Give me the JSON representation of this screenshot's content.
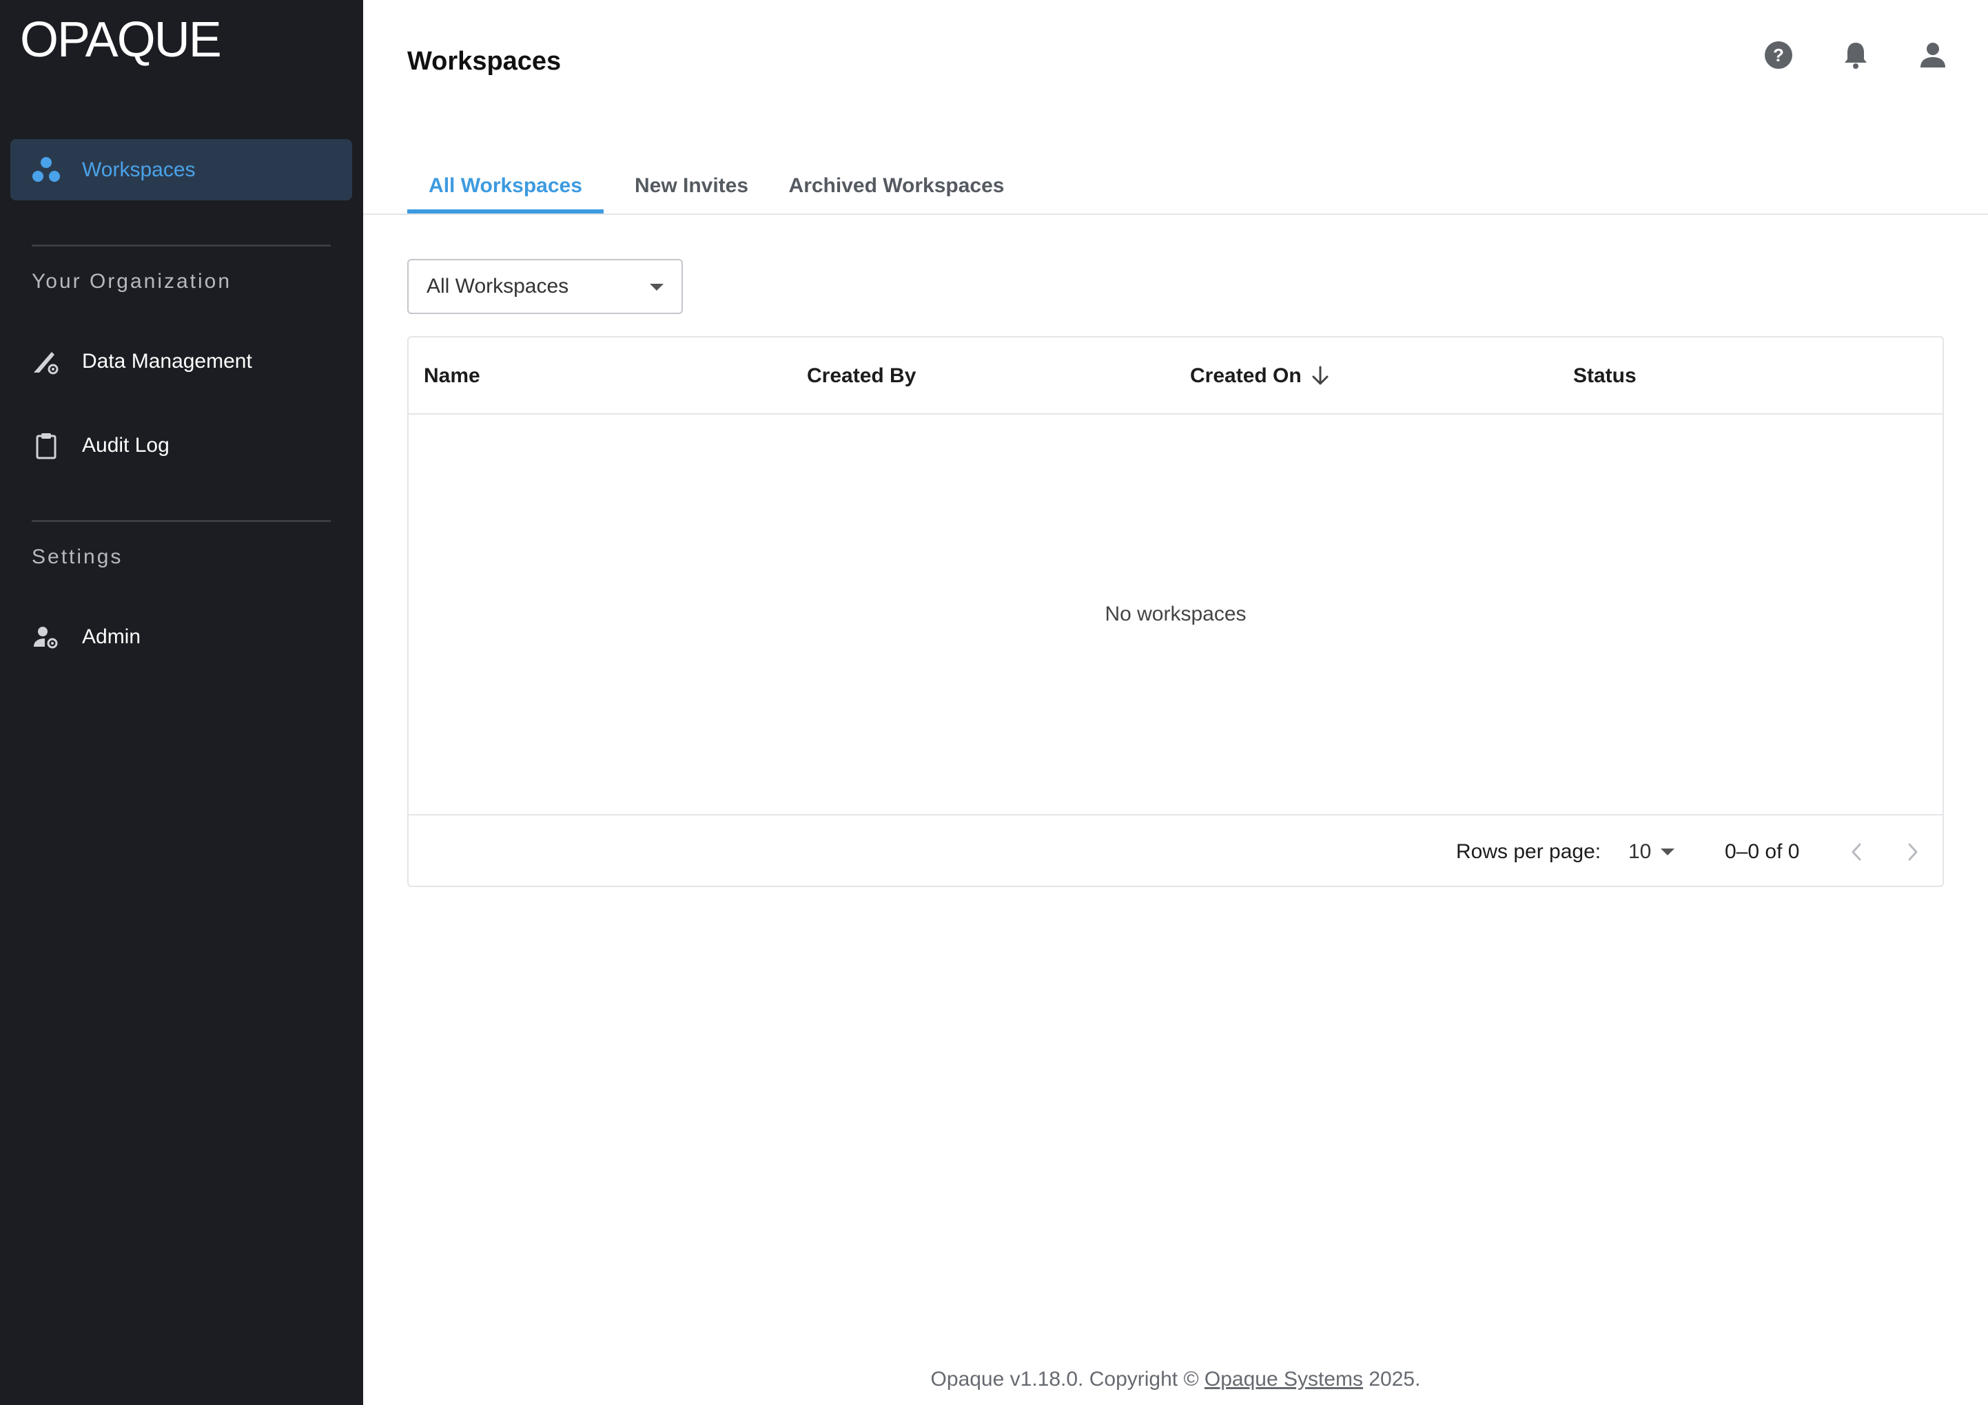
{
  "app": {
    "logo": "OPAQUE"
  },
  "sidebar": {
    "items": [
      {
        "label": "Workspaces",
        "icon": "workspaces-icon",
        "active": true
      },
      {
        "label": "Data Management",
        "icon": "data-management-icon"
      },
      {
        "label": "Audit Log",
        "icon": "clipboard-icon"
      },
      {
        "label": "Admin",
        "icon": "admin-settings-icon"
      }
    ],
    "sections": {
      "organization": "Your Organization",
      "settings": "Settings"
    }
  },
  "header": {
    "title": "Workspaces",
    "icons": [
      "help-icon",
      "notifications-icon",
      "account-icon"
    ]
  },
  "tabs": [
    {
      "label": "All Workspaces",
      "active": true
    },
    {
      "label": "New Invites"
    },
    {
      "label": "Archived Workspaces"
    }
  ],
  "filter": {
    "selected": "All Workspaces"
  },
  "table": {
    "columns": [
      "Name",
      "Created By",
      "Created On",
      "Status"
    ],
    "sorted_column": "Created On",
    "sort_direction": "desc",
    "empty_message": "No workspaces",
    "rows": []
  },
  "pagination": {
    "rows_per_page_label": "Rows per page:",
    "rows_per_page": "10",
    "range": "0–0 of 0"
  },
  "footer": {
    "prefix": "Opaque v1.18.0. Copyright ©",
    "link": "Opaque Systems",
    "suffix": "2025."
  },
  "colors": {
    "sidebar_bg": "#1b1d22",
    "active_item_bg": "#2a3a4e",
    "accent": "#3d9be0"
  }
}
